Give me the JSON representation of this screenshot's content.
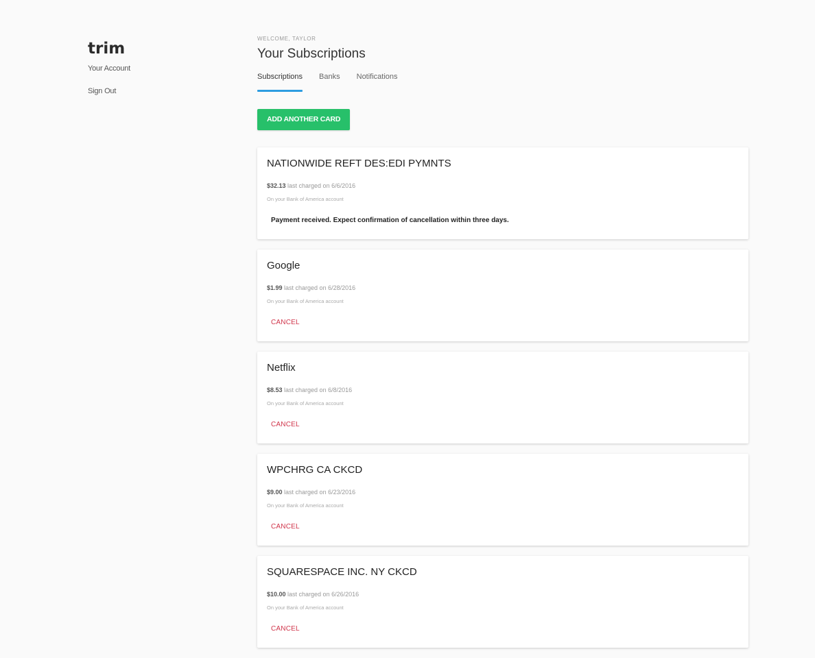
{
  "sidebar": {
    "logo": "trim",
    "links": [
      {
        "label": "Your Account"
      },
      {
        "label": "Sign Out"
      }
    ]
  },
  "header": {
    "welcome": "WELCOME, TAYLOR",
    "title": "Your Subscriptions"
  },
  "tabs": [
    {
      "label": "Subscriptions",
      "active": true
    },
    {
      "label": "Banks",
      "active": false
    },
    {
      "label": "Notifications",
      "active": false
    }
  ],
  "add_card_button": "ADD ANOTHER CARD",
  "cancel_label": "CANCEL",
  "colors": {
    "accent_tab_underline": "#2d9ce0",
    "add_button": "#27c06a",
    "cancel_text": "#d0344a"
  },
  "subscriptions": [
    {
      "name": "NATIONWIDE REFT DES:EDI PYMNTS",
      "amount": "$32.13",
      "charged_text": " last charged on 6/6/2016",
      "account": "On your Bank of America account",
      "status": "Payment received. Expect confirmation of cancellation within three days."
    },
    {
      "name": "Google",
      "amount": "$1.99",
      "charged_text": " last charged on 6/28/2016",
      "account": "On your Bank of America account"
    },
    {
      "name": "Netflix",
      "amount": "$8.53",
      "charged_text": " last charged on 6/8/2016",
      "account": "On your Bank of America account"
    },
    {
      "name": "WPCHRG CA CKCD",
      "amount": "$9.00",
      "charged_text": " last charged on 6/23/2016",
      "account": "On your Bank of America account"
    },
    {
      "name": "SQUARESPACE INC. NY CKCD",
      "amount": "$10.00",
      "charged_text": " last charged on 6/26/2016",
      "account": "On your Bank of America account"
    }
  ]
}
